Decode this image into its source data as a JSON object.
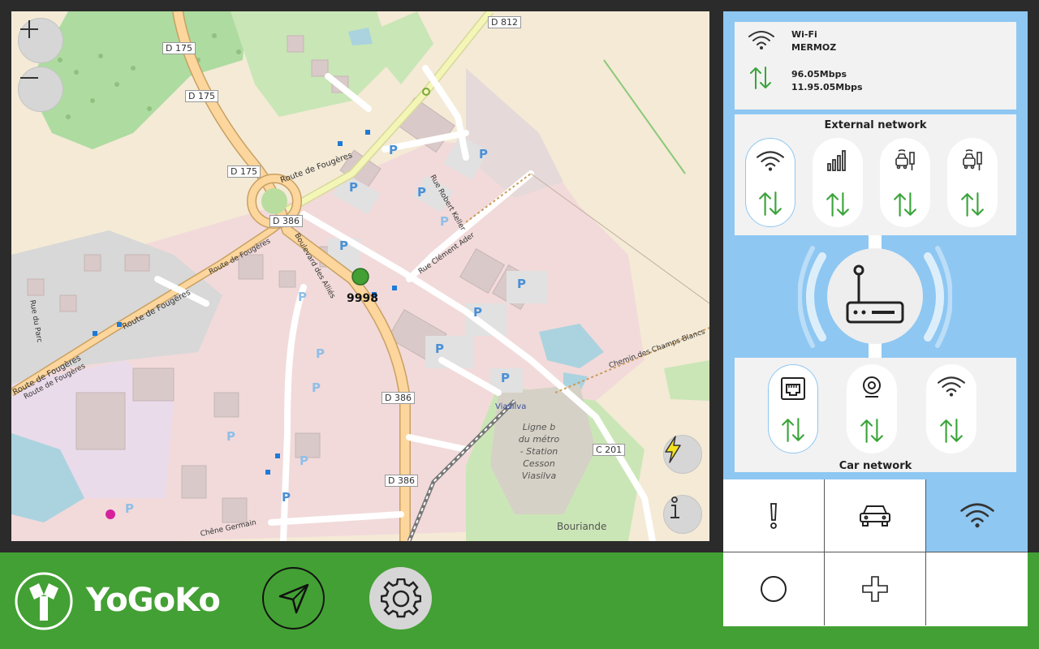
{
  "map": {
    "road_labels": {
      "d175_a": "D 175",
      "d175_b": "D 175",
      "d175_c": "D 175",
      "d812": "D 812",
      "d386_a": "D 386",
      "d386_b": "D 386",
      "d386_c": "D 386",
      "c201": "C 201",
      "route_fougeres_1": "Route de Fougères",
      "route_fougeres_2": "Route de Fougères",
      "route_fougeres_3": "Route de Fougères",
      "route_fougeres_4": "Route de Fougères",
      "route_fougeres_5": "Route de Fougères",
      "rue_parc": "Rue du Parc",
      "bd_allies": "Boulevard des Alliés",
      "rue_robert_keller": "Rue Robert Keller",
      "rue_clement_ader": "Rue Clément Ader",
      "chemin_champs_blancs": "Chemin des Champs Blancs",
      "chene_germain": "Chêne Germain",
      "viasilva": "Viasilva",
      "metro_1": "Ligne b",
      "metro_2": "du métro",
      "metro_3": "- Station",
      "metro_4": "Cesson",
      "metro_5": "Viasilva",
      "bouriande": "Bouriande",
      "parking": "P"
    },
    "vehicle_id": "9998",
    "zoom_in_icon": "plus-icon",
    "zoom_out_icon": "minus-icon",
    "power_icon": "lightning-icon",
    "info_icon": "info-icon"
  },
  "wifi_info": {
    "type": "Wi-Fi",
    "ssid": "MERMOZ",
    "down": "96.05Mbps",
    "up": "11.95.05Mbps"
  },
  "external_network": {
    "title": "External network",
    "items": [
      {
        "icon": "wifi-icon",
        "selected": true
      },
      {
        "icon": "cellular-signal-icon",
        "selected": false
      },
      {
        "icon": "vehicle-to-infrastructure-icon",
        "selected": false
      },
      {
        "icon": "vehicle-to-infrastructure-icon",
        "selected": false
      }
    ]
  },
  "car_network": {
    "title": "Car network",
    "items": [
      {
        "icon": "ethernet-icon",
        "selected": true
      },
      {
        "icon": "webcam-icon",
        "selected": false
      },
      {
        "icon": "wifi-icon",
        "selected": false
      }
    ]
  },
  "nav_grid": {
    "cells": [
      {
        "icon": "alert-icon",
        "active": false
      },
      {
        "icon": "car-icon",
        "active": false
      },
      {
        "icon": "wifi-icon",
        "active": true
      },
      {
        "icon": "circle-icon",
        "active": false
      },
      {
        "icon": "plus-icon",
        "active": false
      },
      {
        "icon": "",
        "active": false
      }
    ]
  },
  "bottom_bar": {
    "brand": "YoGoKo",
    "navigate_icon": "navigation-arrow-icon",
    "settings_icon": "gear-icon"
  },
  "colors": {
    "accent_green": "#43a034",
    "accent_blue": "#8ec7f2",
    "arrow_green": "#3aa43a"
  }
}
